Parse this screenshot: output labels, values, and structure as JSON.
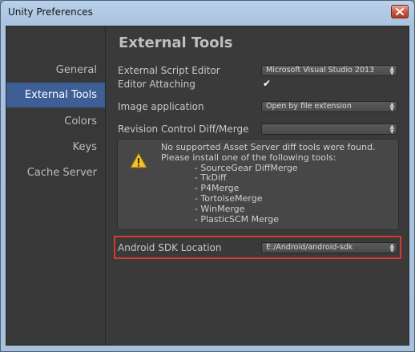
{
  "window": {
    "title": "Unity Preferences"
  },
  "sidebar": {
    "items": [
      {
        "label": "General",
        "active": false
      },
      {
        "label": "External Tools",
        "active": true
      },
      {
        "label": "Colors",
        "active": false
      },
      {
        "label": "Keys",
        "active": false
      },
      {
        "label": "Cache Server",
        "active": false
      }
    ]
  },
  "panel": {
    "title": "External Tools",
    "script_editor": {
      "label": "External Script Editor",
      "value": "Microsoft Visual Studio 2013"
    },
    "editor_attaching": {
      "label": "Editor Attaching",
      "checked": true
    },
    "image_application": {
      "label": "Image application",
      "value": "Open by file extension"
    },
    "revision_control": {
      "label": "Revision Control Diff/Merge",
      "value": ""
    },
    "help_box": {
      "icon": "warning-icon",
      "lines": [
        "No supported Asset Server diff tools were found.",
        "Please install one of the following tools:",
        "            - SourceGear DiffMerge",
        "            - TkDiff",
        "            - P4Merge",
        "            - TortoiseMerge",
        "            - WinMerge",
        "            - PlasticSCM Merge"
      ]
    },
    "android_sdk": {
      "label": "Android SDK Location",
      "value": "E:/Android/android-sdk"
    }
  },
  "colors": {
    "highlight": "#d63a2c",
    "active_item": "#3e5f96",
    "background": "#383838"
  }
}
